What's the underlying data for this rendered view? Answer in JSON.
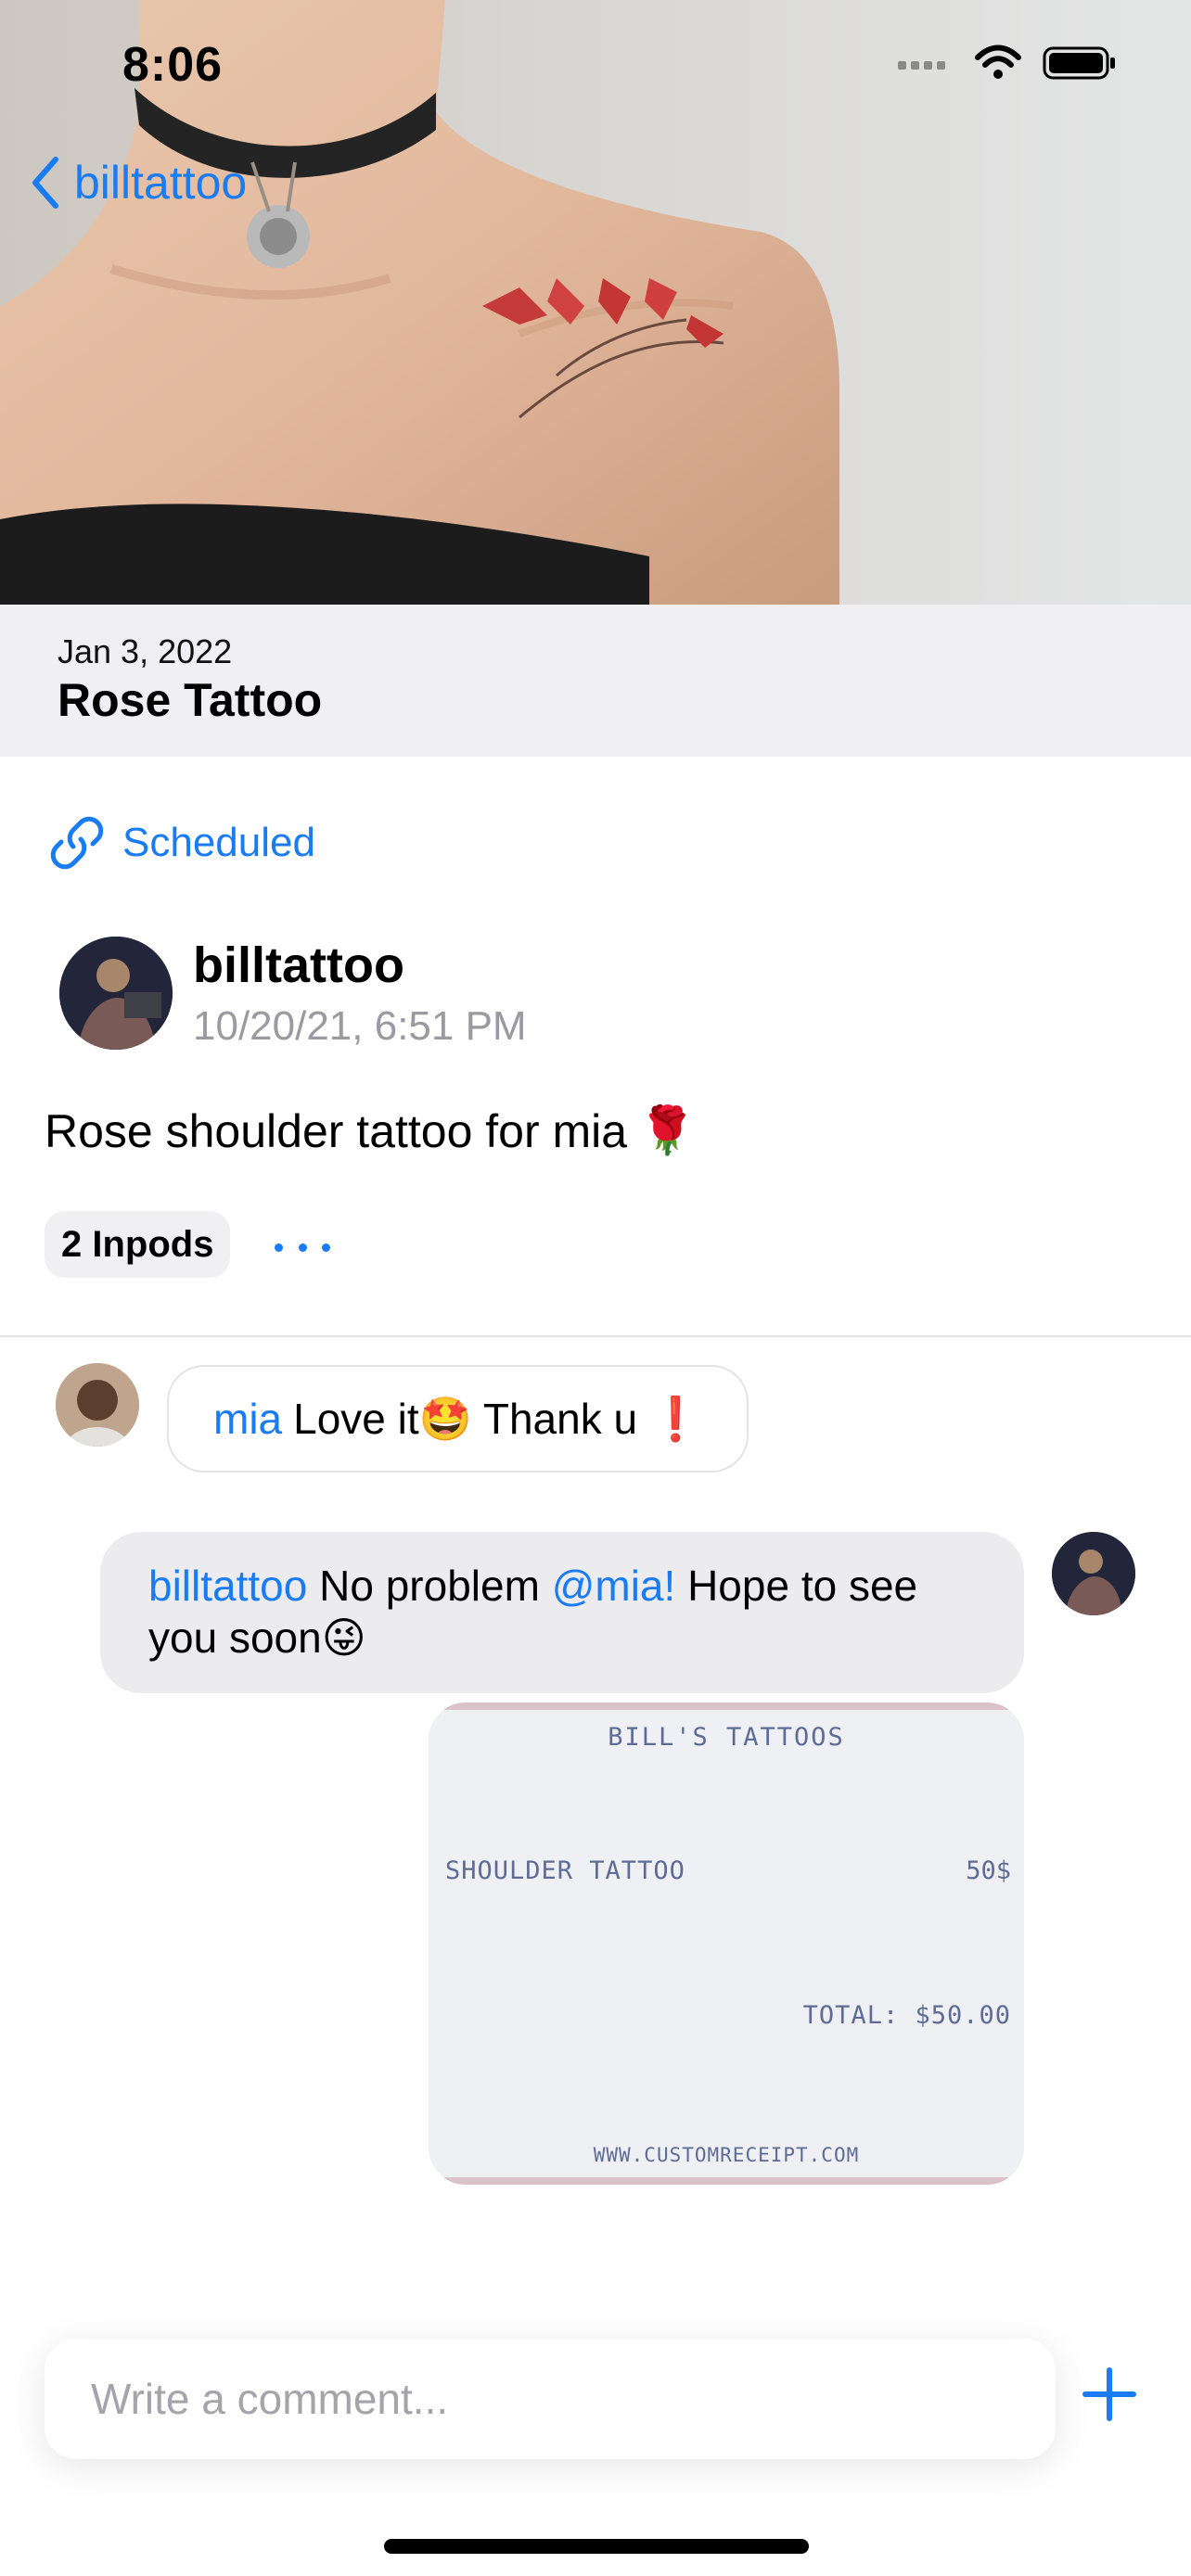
{
  "status_bar": {
    "time": "8:06"
  },
  "nav": {
    "back_label": "billtattoo"
  },
  "header": {
    "date": "Jan 3, 2022",
    "title": "Rose Tattoo"
  },
  "post": {
    "status_label": "Scheduled",
    "author": "billtattoo",
    "timestamp": "10/20/21, 6:51 PM",
    "text": "Rose shoulder tattoo for mia",
    "text_emoji": "🌹",
    "inpods_label": "2 Inpods"
  },
  "comments": [
    {
      "mention": "mia",
      "text": "Love it🤩 Thank u ❗"
    },
    {
      "author_mention": "billtattoo",
      "text_a": "No problem",
      "mention": "@mia!",
      "text_b": "Hope to see you soon😜"
    }
  ],
  "receipt": {
    "header": "BILL'S TATTOOS",
    "item": "SHOULDER TATTOO",
    "price": "50$",
    "total": "TOTAL: $50.00",
    "footer": "WWW.CUSTOMRECEIPT.COM"
  },
  "composer": {
    "placeholder": "Write a comment..."
  },
  "colors": {
    "accent": "#1a7cf2",
    "band": "#f0f0f3",
    "bubble": "#ececef"
  }
}
